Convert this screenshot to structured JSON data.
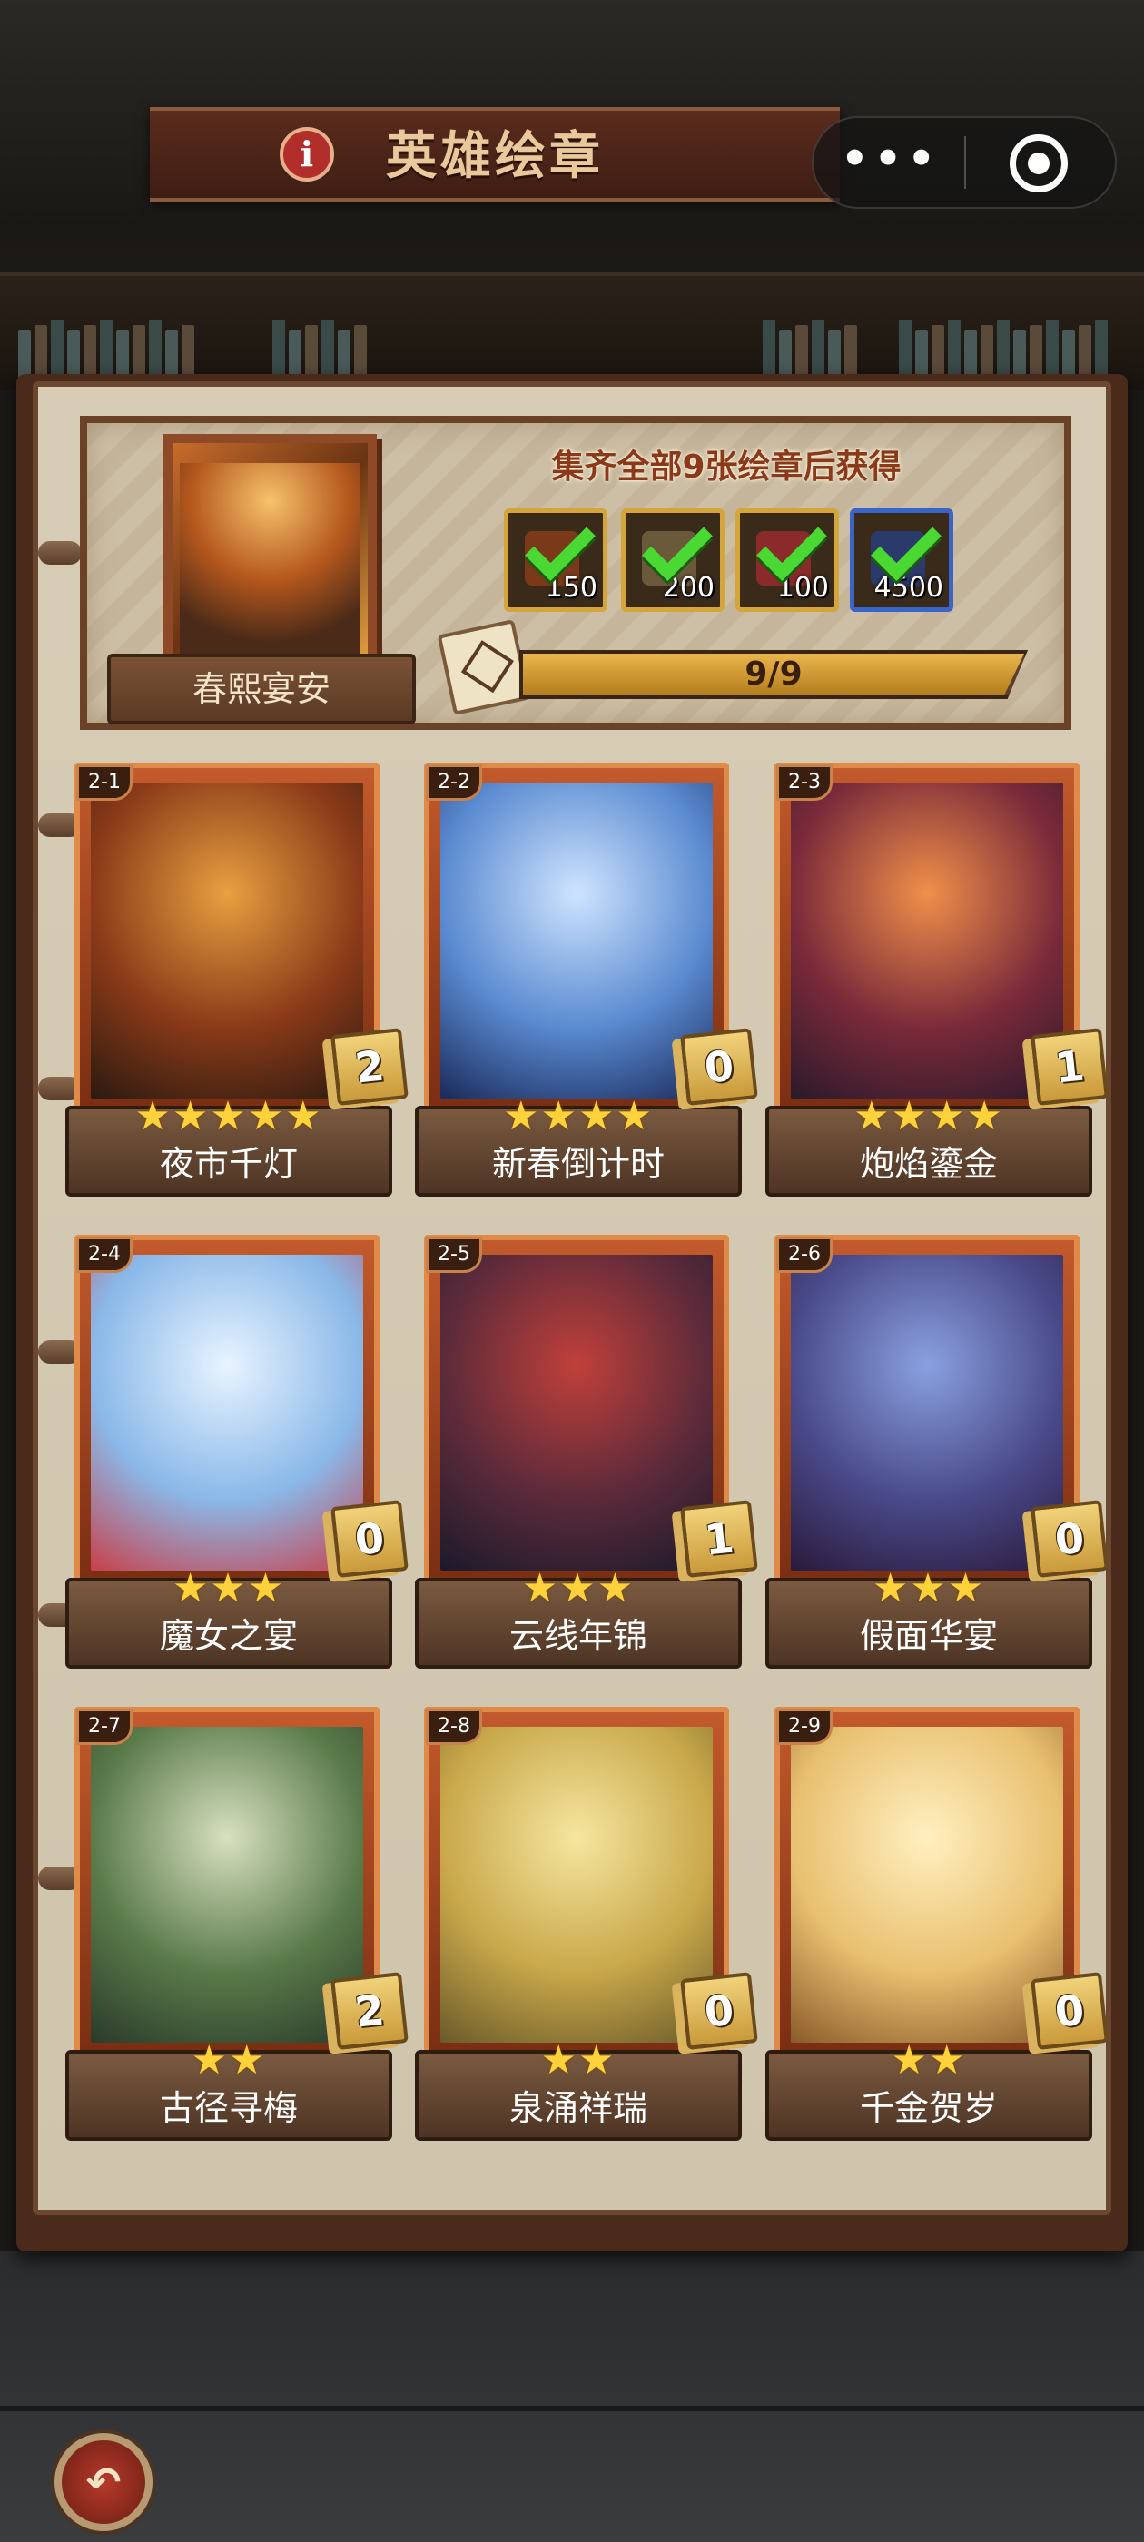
{
  "header": {
    "title": "英雄绘章",
    "info_label": "i",
    "more_label": "•••"
  },
  "album": {
    "name": "春熙宴安",
    "reward_title": "集齐全部9张绘章后获得",
    "rewards": [
      {
        "value": "150",
        "border_color": "#d4a53a",
        "icon_color": "#7a3a1a"
      },
      {
        "value": "200",
        "border_color": "#d4a53a",
        "icon_color": "#6a5a3a"
      },
      {
        "value": "100",
        "border_color": "#d4a53a",
        "icon_color": "#8a2a2a"
      },
      {
        "value": "4500",
        "border_color": "#3a64c8",
        "icon_color": "#2a3a6a"
      }
    ],
    "progress": {
      "text": "9/9",
      "fraction": 1.0
    }
  },
  "cards": [
    {
      "id": "2-1",
      "name": "夜市千灯",
      "stars": 5,
      "count": "2",
      "art": [
        "#e8a040",
        "#8a3a18",
        "#2a1a10"
      ]
    },
    {
      "id": "2-2",
      "name": "新春倒计时",
      "stars": 4,
      "count": "0",
      "art": [
        "#cfe4ff",
        "#5a8ad0",
        "#1a2a5a"
      ]
    },
    {
      "id": "2-3",
      "name": "炮焰鎏金",
      "stars": 4,
      "count": "1",
      "art": [
        "#f0904a",
        "#7a2a3a",
        "#2a1a2a"
      ]
    },
    {
      "id": "2-4",
      "name": "魔女之宴",
      "stars": 3,
      "count": "0",
      "art": [
        "#e8f4ff",
        "#8ab8e8",
        "#c8404a"
      ]
    },
    {
      "id": "2-5",
      "name": "云线年锦",
      "stars": 3,
      "count": "1",
      "art": [
        "#c0403a",
        "#5a2a3a",
        "#1a1a2a"
      ]
    },
    {
      "id": "2-6",
      "name": "假面华宴",
      "stars": 3,
      "count": "0",
      "art": [
        "#8aa0e0",
        "#4a4a8a",
        "#2a1a3a"
      ]
    },
    {
      "id": "2-7",
      "name": "古径寻梅",
      "stars": 2,
      "count": "2",
      "art": [
        "#d8e0c0",
        "#5a7a4a",
        "#2a3a2a"
      ]
    },
    {
      "id": "2-8",
      "name": "泉涌祥瑞",
      "stars": 2,
      "count": "0",
      "art": [
        "#f6e6a0",
        "#c8a84a",
        "#6a5a2a"
      ]
    },
    {
      "id": "2-9",
      "name": "千金贺岁",
      "stars": 2,
      "count": "0",
      "art": [
        "#fff0c0",
        "#e8c070",
        "#8a5a2a"
      ]
    }
  ],
  "footer": {
    "back_label": "↶"
  }
}
